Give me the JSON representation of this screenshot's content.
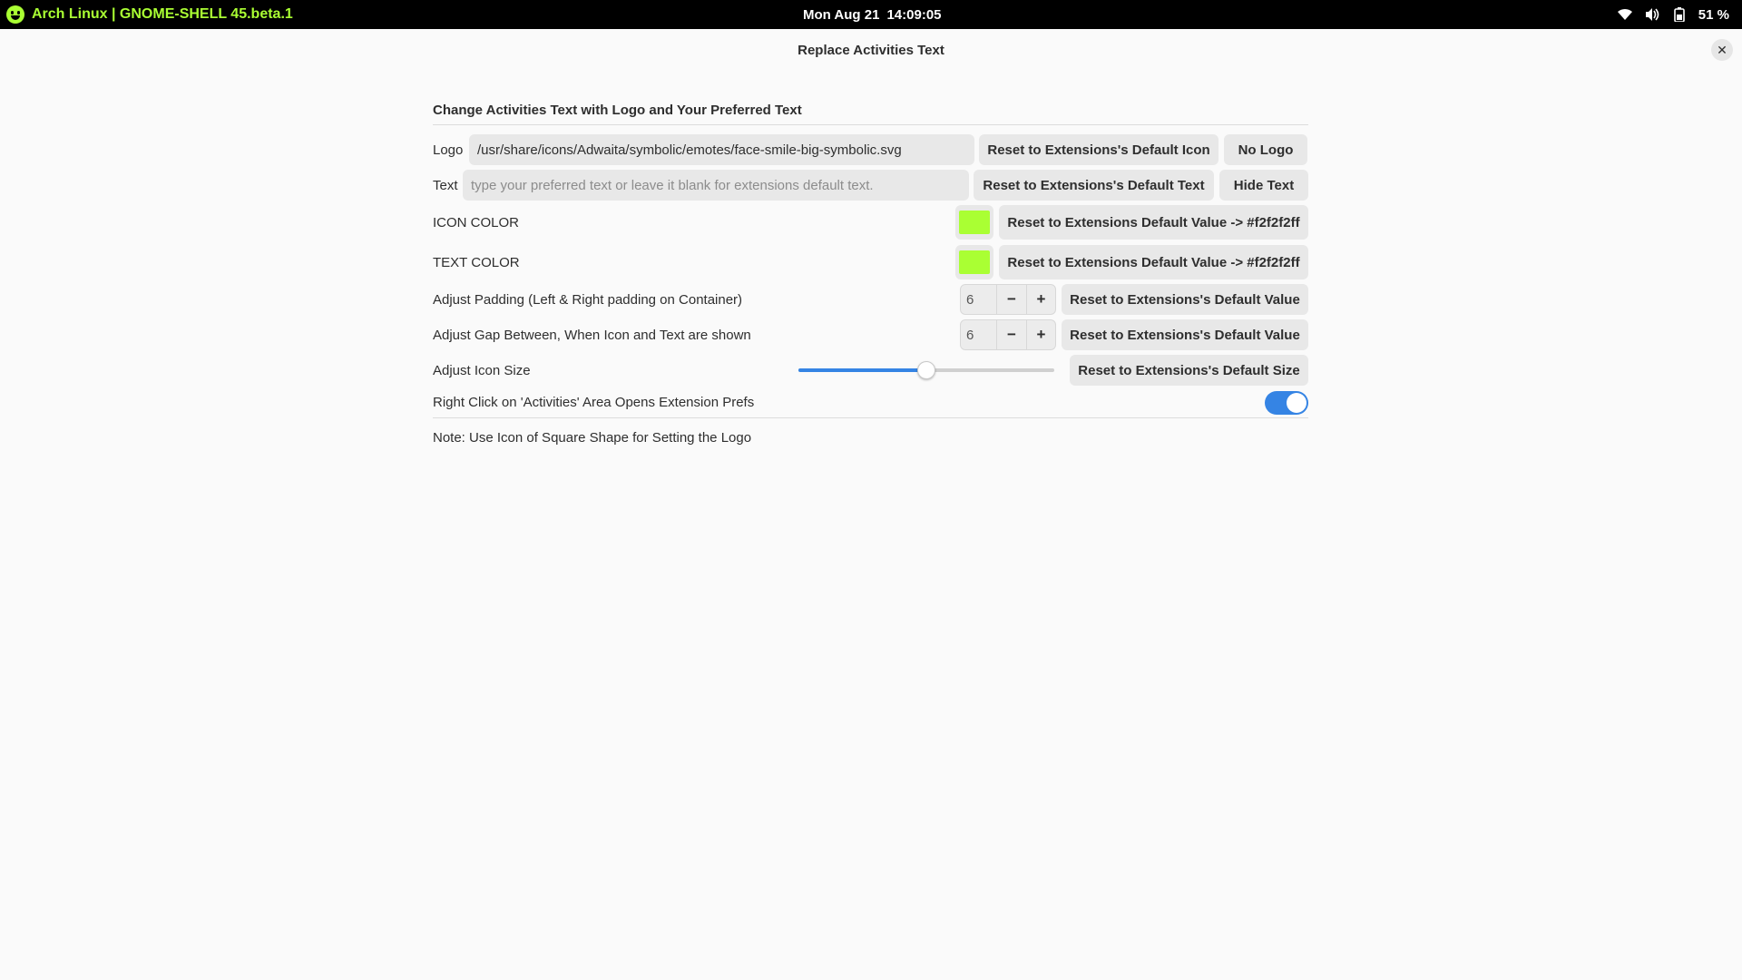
{
  "topbar": {
    "activities_text": "Arch Linux | GNOME-SHELL 45.beta.1",
    "activities_icon": "face-smile-icon",
    "clock_date": "Mon Aug 21",
    "clock_time": "14:09:05",
    "battery_percent": "51 %",
    "icons": [
      "wifi-icon",
      "volume-icon",
      "battery-icon"
    ]
  },
  "window": {
    "title": "Replace Activities Text"
  },
  "main": {
    "section_title": "Change Activities Text with Logo and Your Preferred Text",
    "logo": {
      "label": "Logo",
      "value": "/usr/share/icons/Adwaita/symbolic/emotes/face-smile-big-symbolic.svg",
      "reset_label": "Reset to Extensions's Default Icon",
      "no_logo_label": "No Logo"
    },
    "text": {
      "label": "Text",
      "value": "",
      "placeholder": "type your preferred text or leave it blank for extensions default text.",
      "reset_label": "Reset to Extensions's Default Text",
      "hide_label": "Hide Text"
    },
    "icon_color": {
      "label": "ICON COLOR",
      "color": "#aaff33",
      "reset_label": "Reset to Extensions Default Value -> #f2f2f2ff"
    },
    "text_color": {
      "label": "TEXT COLOR",
      "color": "#aaff33",
      "reset_label": "Reset to Extensions Default Value -> #f2f2f2ff"
    },
    "padding": {
      "label": "Adjust Padding (Left & Right padding on Container)",
      "value": "6",
      "minus": "−",
      "plus": "+",
      "reset_label": "Reset to Extensions's Default Value"
    },
    "gap": {
      "label": "Adjust Gap Between, When Icon and Text are shown",
      "value": "6",
      "minus": "−",
      "plus": "+",
      "reset_label": "Reset to Extensions's Default Value"
    },
    "icon_size": {
      "label": "Adjust Icon Size",
      "slider_fraction": 0.5,
      "reset_label": "Reset to Extensions's Default Size"
    },
    "right_click": {
      "label": "Right Click on 'Activities' Area Opens Extension Prefs",
      "enabled": true
    },
    "note": "Note: Use Icon of Square Shape for Setting the Logo"
  },
  "colors": {
    "accent": "#3584e4",
    "swatch": "#aaff33",
    "button_bg": "#e8e8e8"
  }
}
